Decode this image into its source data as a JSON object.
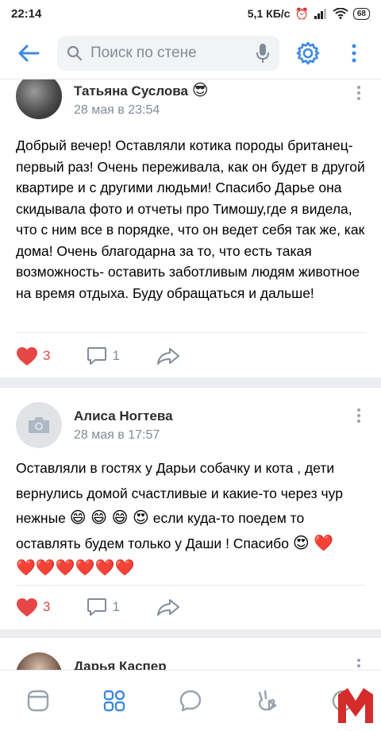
{
  "status_bar": {
    "time": "22:14",
    "net_speed": "5,1 КБ/с",
    "battery": "68"
  },
  "header": {
    "search_placeholder": "Поиск по стене"
  },
  "posts": [
    {
      "author": "Татьяна Суслова",
      "author_emoji": "😎",
      "date": "28 мая в 23:54",
      "text": "Добрый вечер! Оставляли котика породы британец-первый раз! Очень переживала, как он будет в другой квартире и с другими людьми! Спасибо Дарье она скидывала фото и отчеты про Тимошу,где я видела, что с ним все в порядке, что он ведет себя так же, как дома! Очень благодарна за то, что есть такая возможность- оставить заботливым людям животное на время отдыха. Буду обращаться и дальше!",
      "likes": "3",
      "comments": "1"
    },
    {
      "author": "Алиса Ногтева",
      "date": "28 мая в 17:57",
      "text_line1": "Оставляли в гостях у Дарьи собачку и кота , дети вернулись домой счастливые и какие-то через чур нежные",
      "text_emojis1": "😄 😄 😄 😍",
      "text_line2": "если куда-то поедем то оставлять будем только у Даши ! Спасибо",
      "text_emojis2": "😍 ❤️",
      "text_emojis3": "❤️❤️❤️❤️❤️❤️",
      "likes": "3",
      "comments": "1"
    },
    {
      "author": "Дарья Каспер"
    }
  ],
  "icons": {
    "back": "arrow-left-icon",
    "search": "search-icon",
    "mic": "microphone-icon",
    "settings": "gear-icon",
    "more": "vertical-dots-icon",
    "like": "heart-icon",
    "comment": "comment-icon",
    "share": "share-icon"
  },
  "colors": {
    "accent": "#3f8ae0",
    "like": "#e64646",
    "secondary_text": "#818c99"
  }
}
